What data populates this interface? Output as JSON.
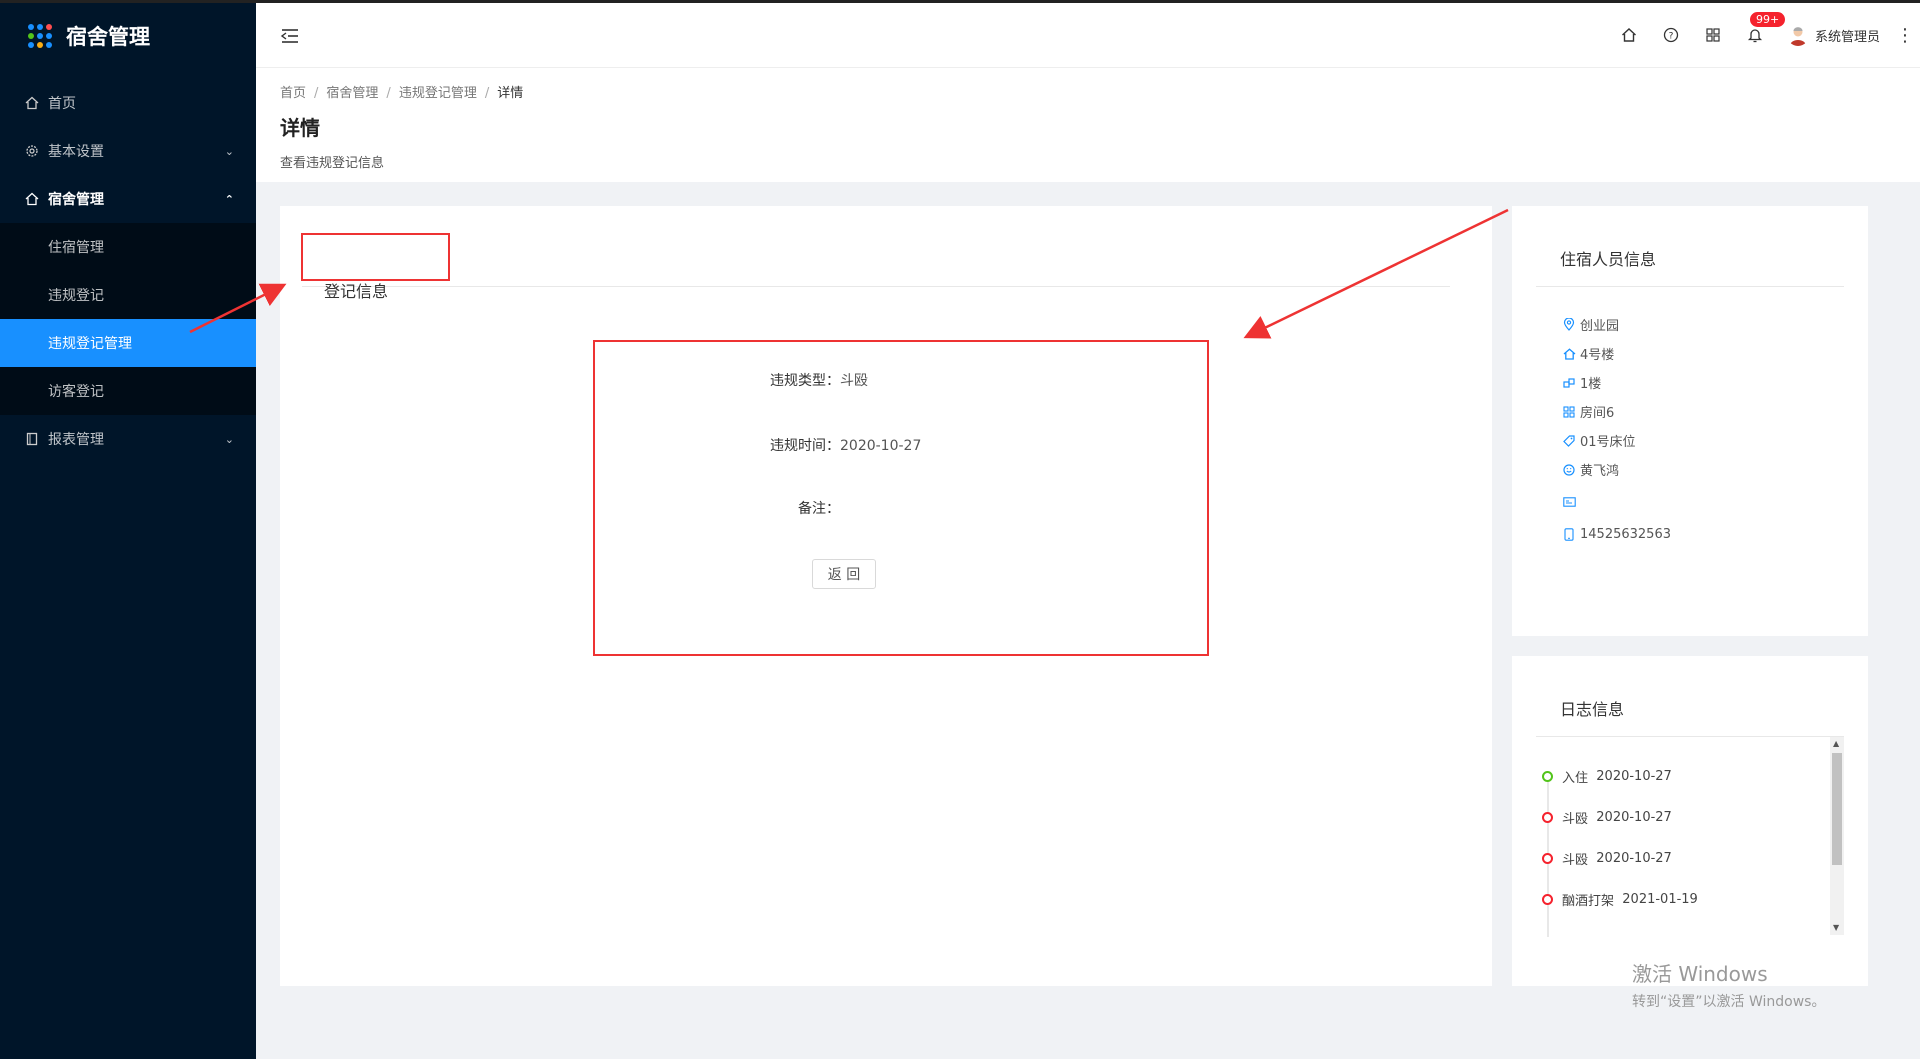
{
  "sidebar": {
    "title": "宿舍管理",
    "logo_colors": [
      "#1890ff",
      "#1890ff",
      "#ff4d4f",
      "#52c41a",
      "#1890ff",
      "#1890ff",
      "#1890ff",
      "#faad14",
      "#1890ff"
    ],
    "items": [
      {
        "label": "首页",
        "icon": "home-icon"
      },
      {
        "label": "基本设置",
        "icon": "gear-icon"
      },
      {
        "label": "宿舍管理",
        "icon": "home-icon"
      },
      {
        "label": "报表管理",
        "icon": "file-icon"
      }
    ],
    "sub_items": [
      "住宿管理",
      "违规登记",
      "违规登记管理",
      "访客登记"
    ]
  },
  "header": {
    "badge": "99+",
    "user_name": "系统管理员"
  },
  "breadcrumb": {
    "items": [
      "首页",
      "宿舍管理",
      "违规登记管理",
      "详情"
    ]
  },
  "page": {
    "title": "详情",
    "desc": "查看违规登记信息"
  },
  "main_card": {
    "title": "登记信息",
    "fields": [
      {
        "label": "违规类型：",
        "value": "斗殴"
      },
      {
        "label": "违规时间：",
        "value": "2020-10-27"
      },
      {
        "label": "备注：",
        "value": ""
      }
    ],
    "back_label": "返 回"
  },
  "resident_card": {
    "title": "住宿人员信息",
    "rows": [
      {
        "icon": "location-icon",
        "text": "创业园"
      },
      {
        "icon": "home-icon",
        "text": "4号楼"
      },
      {
        "icon": "building-icon",
        "text": "1楼"
      },
      {
        "icon": "grid-icon",
        "text": "房间6"
      },
      {
        "icon": "tag-icon",
        "text": "01号床位"
      },
      {
        "icon": "smile-icon",
        "text": "黄飞鸿"
      },
      {
        "icon": "id-card-icon",
        "text": ""
      },
      {
        "icon": "phone-icon",
        "text": "14525632563"
      }
    ]
  },
  "log_card": {
    "title": "日志信息",
    "items": [
      {
        "text": "入住",
        "date": "2020-10-27",
        "color": "green"
      },
      {
        "text": "斗殴",
        "date": "2020-10-27",
        "color": "red"
      },
      {
        "text": "斗殴",
        "date": "2020-10-27",
        "color": "red"
      },
      {
        "text": "酗酒打架",
        "date": "2021-01-19",
        "color": "red"
      }
    ]
  },
  "watermark": {
    "line1": "激活 Windows",
    "line2": "转到“设置”以激活 Windows。"
  }
}
